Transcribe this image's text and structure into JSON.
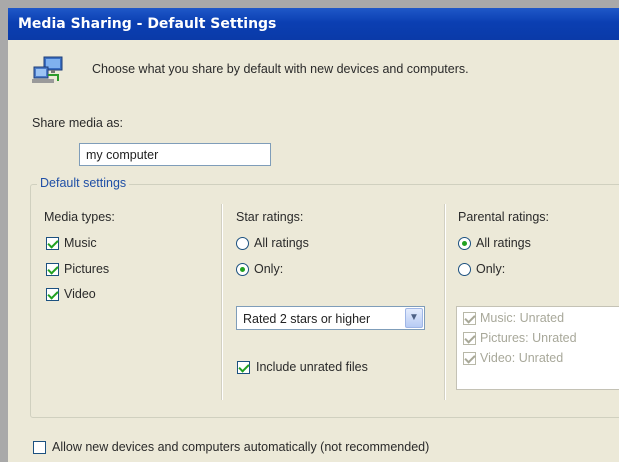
{
  "window": {
    "title": "Media Sharing - Default Settings"
  },
  "intro": {
    "icon": "media-sharing-icon",
    "text": "Choose what you share by default with new devices and computers."
  },
  "share": {
    "label": "Share media as:",
    "value": "my computer"
  },
  "default_settings": {
    "legend": "Default settings",
    "media_types": {
      "title": "Media types:",
      "items": [
        {
          "label": "Music",
          "checked": true
        },
        {
          "label": "Pictures",
          "checked": true
        },
        {
          "label": "Video",
          "checked": true
        }
      ]
    },
    "star_ratings": {
      "title": "Star ratings:",
      "options": [
        {
          "label": "All ratings",
          "selected": false
        },
        {
          "label": "Only:",
          "selected": true
        }
      ],
      "dropdown_value": "Rated 2 stars or higher",
      "include_unrated": {
        "label": "Include unrated files",
        "checked": true
      }
    },
    "parental_ratings": {
      "title": "Parental ratings:",
      "options": [
        {
          "label": "All ratings",
          "selected": true
        },
        {
          "label": "Only:",
          "selected": false
        }
      ],
      "list": [
        {
          "label": "Music: Unrated",
          "checked": true
        },
        {
          "label": "Pictures: Unrated",
          "checked": true
        },
        {
          "label": "Video: Unrated",
          "checked": true
        }
      ]
    }
  },
  "allow_new_devices": {
    "label": "Allow new devices and computers automatically (not recommended)",
    "checked": false
  }
}
